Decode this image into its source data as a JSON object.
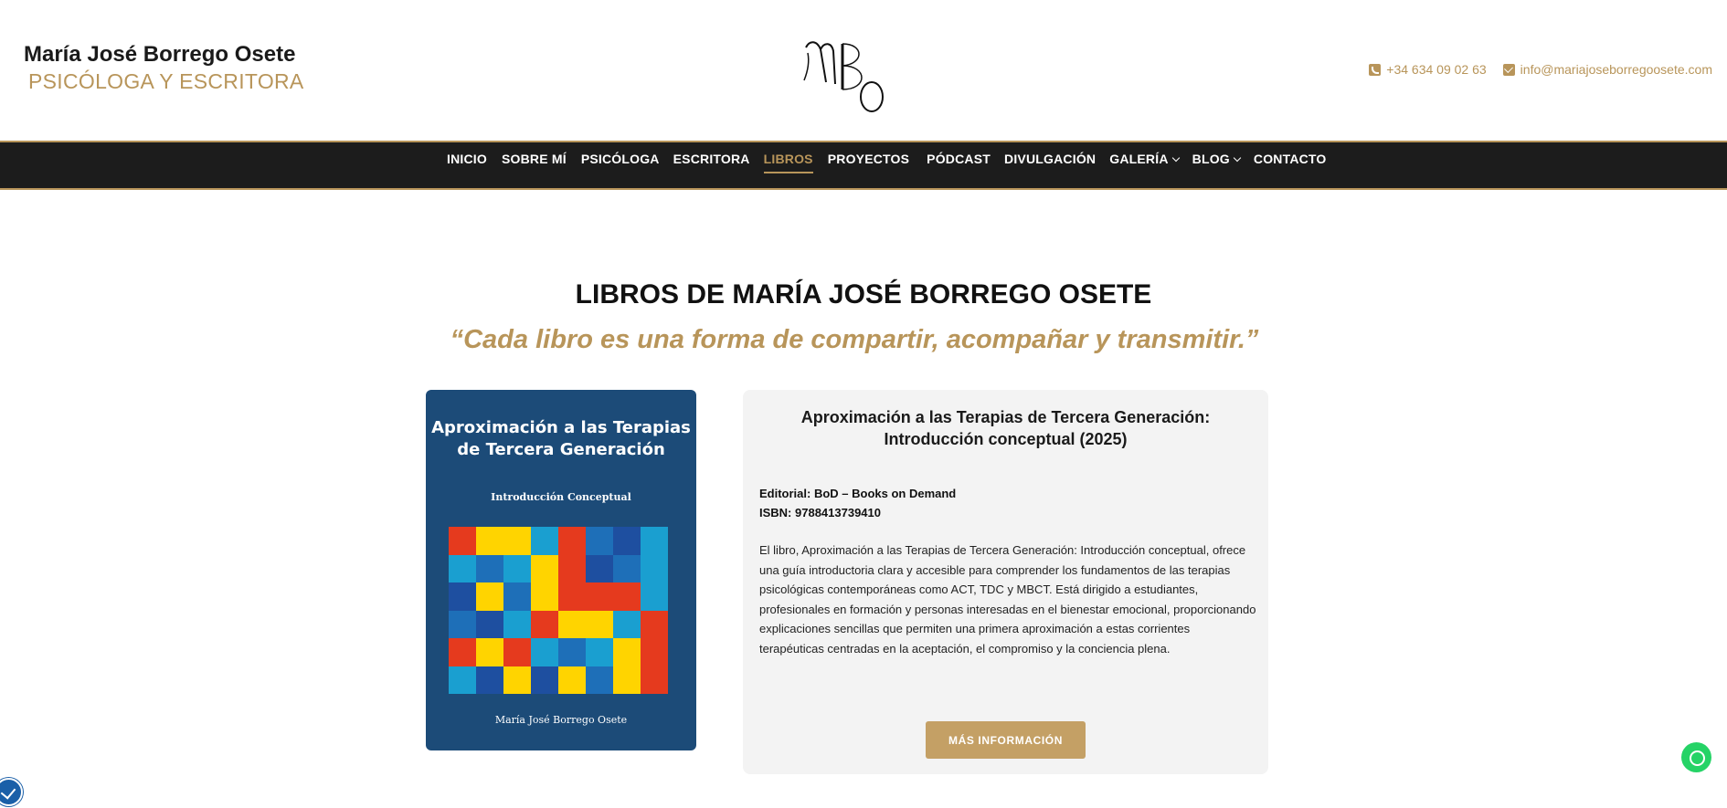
{
  "header": {
    "brand_name": "María José Borrego Osete",
    "brand_subtitle": "PSICÓLOGA Y ESCRITORA",
    "logo_text": "MBO",
    "phone": "+34 634 09 02 63",
    "email": "info@mariajoseborregoosete.com"
  },
  "nav": {
    "items": [
      {
        "label": "INICIO"
      },
      {
        "label": "SOBRE MÍ"
      },
      {
        "label": "PSICÓLOGA"
      },
      {
        "label": "ESCRITORA"
      },
      {
        "label": "LIBROS",
        "active": true
      },
      {
        "label": "PROYECTOS"
      },
      {
        "label": "PÓDCAST"
      },
      {
        "label": "DIVULGACIÓN"
      },
      {
        "label": "GALERÍA",
        "dropdown": true
      },
      {
        "label": "BLOG",
        "dropdown": true
      },
      {
        "label": "CONTACTO"
      }
    ]
  },
  "main": {
    "title": "LIBROS DE MARÍA JOSÉ BORREGO OSETE",
    "quote": "“Cada libro es una forma de compartir, acompañar y transmitir.”"
  },
  "book": {
    "cover_title_line1": "Aproximación a las Terapias",
    "cover_title_line2": "de Tercera Generación",
    "cover_subtitle": "Introducción Conceptual",
    "cover_author": "María José Borrego Osete",
    "title_line1": "Aproximación a las Terapias de Tercera Generación:",
    "title_line2": "Introducción conceptual (2025)",
    "editorial": "Editorial: BoD – Books on Demand",
    "isbn": "ISBN: 9788413739410",
    "description": "El libro, Aproximación a las Terapias de Tercera Generación: Introducción conceptual, ofrece una guía introductoria clara y accesible para comprender los fundamentos de las terapias psicológicas contemporáneas como ACT, TDC y MBCT. Está dirigido a estudiantes, profesionales en formación y personas interesadas en el bienestar emocional, proporcionando explicaciones sencillas que permiten una primera aproximación a estas corrientes terapéuticas centradas en la aceptación, el compromiso y la conciencia plena.",
    "button_label": "MÁS INFORMACIÓN"
  },
  "colors": {
    "accent_gold": "#b8955a",
    "nav_bg": "#1c1c1c",
    "cover_blue": "#1c4b78",
    "card_bg": "#f3f3f3",
    "puzzle": [
      "#e53a1e",
      "#1e6fb8",
      "#ffd400",
      "#1a9fd0",
      "#e53a1e",
      "#ffd400",
      "#1e4fa0",
      "#1a9fd0"
    ]
  },
  "icons": {
    "phone": "phone-icon",
    "email": "mail-icon",
    "whatsapp": "whatsapp-icon",
    "accessibility": "accessibility-icon"
  }
}
